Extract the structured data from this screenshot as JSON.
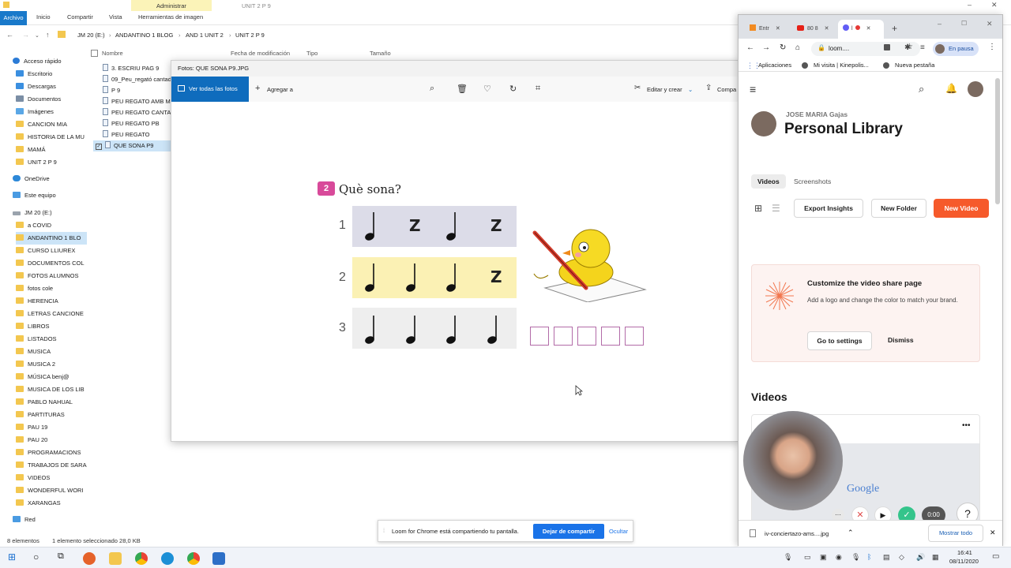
{
  "explorer": {
    "title_path": "UNIT 2 P 9",
    "ribbon_context": "Administrar",
    "tabs": [
      "Archivo",
      "Inicio",
      "Compartir",
      "Vista",
      "Herramientas de imagen"
    ],
    "breadcrumb": [
      "JM 20 (E:)",
      "ANDANTINO 1 BLOG",
      "AND 1 UNIT 2",
      "UNIT 2 P 9"
    ],
    "columns": [
      "Nombre",
      "Fecha de modificación",
      "Tipo",
      "Tamaño"
    ],
    "quick_access": "Acceso rápido",
    "pinned": [
      "Escritorio",
      "Descargas",
      "Documentos",
      "Imágenes"
    ],
    "folders_top": [
      "CANCION MIA",
      "HISTORIA DE LA MU",
      "MAMÁ",
      "UNIT 2 P 9"
    ],
    "onedrive": "OneDrive",
    "this_pc": "Este equipo",
    "drive": "JM 20 (E:)",
    "drive_folders": [
      "a COVID",
      "ANDANTINO 1 BLO",
      "CURSO LLIUREX",
      "DOCUMENTOS COL",
      "FOTOS ALUMNOS",
      "fotos cole",
      "HERENCIA",
      "LETRAS CANCIONE",
      "LIBROS",
      "LISTADOS",
      "MUSICA",
      "MUSICA 2",
      "MÚSICA benj@",
      "MUSICA DE LOS LIB",
      "PABLO NAHUAL",
      "PARTITURAS",
      "PAU 19",
      "PAU 20",
      "PROGRAMACIONS",
      "TRABAJOS DE SARA",
      "VIDEOS",
      "WONDERFUL WORI",
      "XARANGAS"
    ],
    "network": "Red",
    "files": [
      "3. ESCRIU PAG 9",
      "09_Peu_regató cantad",
      "P 9",
      "PEU REGATO AMB MU",
      "PEU REGATO CANTAD",
      "PEU REGATO PB",
      "PEU REGATO",
      "QUE SONA P9"
    ],
    "status_count": "8 elementos",
    "status_selected": "1 elemento seleccionado  28,0 KB"
  },
  "photos": {
    "title": "Fotos: QUE SONA P9.JPG",
    "view_all": "Ver todas las fotos",
    "add_to": "Agregar a",
    "edit_create": "Editar y crear",
    "share": "Compa",
    "sheet_badge": "2",
    "sheet_title": "Què sona?",
    "rows": [
      "1",
      "2",
      "3"
    ]
  },
  "chrome": {
    "tabs": [
      "Entr",
      "80 8",
      "l"
    ],
    "url": "loom....",
    "paused": "En pausa",
    "bookmarks": [
      "Aplicaciones",
      "Mi visita | Kinepolis...",
      "Nueva pestaña"
    ]
  },
  "loom": {
    "user": "JOSE MARIA Gajas",
    "library_title": "Personal Library",
    "tab_videos": "Videos",
    "tab_screenshots": "Screenshots",
    "export": "Export Insights",
    "new_folder": "New Folder",
    "new_video": "New Video",
    "promo_title": "Customize the video share page",
    "promo_text": "Add a logo and change the color to match your brand.",
    "go_settings": "Go to settings",
    "dismiss": "Dismiss",
    "videos_heading": "Videos",
    "timer": "0:00",
    "download_file": "iv-conciertazo-ams....jpg",
    "show_all": "Mostrar todo"
  },
  "sharebar": {
    "message": "Loom for Chrome está compartiendo tu pantalla.",
    "stop": "Dejar de compartir",
    "hide": "Ocultar"
  },
  "taskbar": {
    "time": "16:41",
    "date": "08/11/2020"
  }
}
